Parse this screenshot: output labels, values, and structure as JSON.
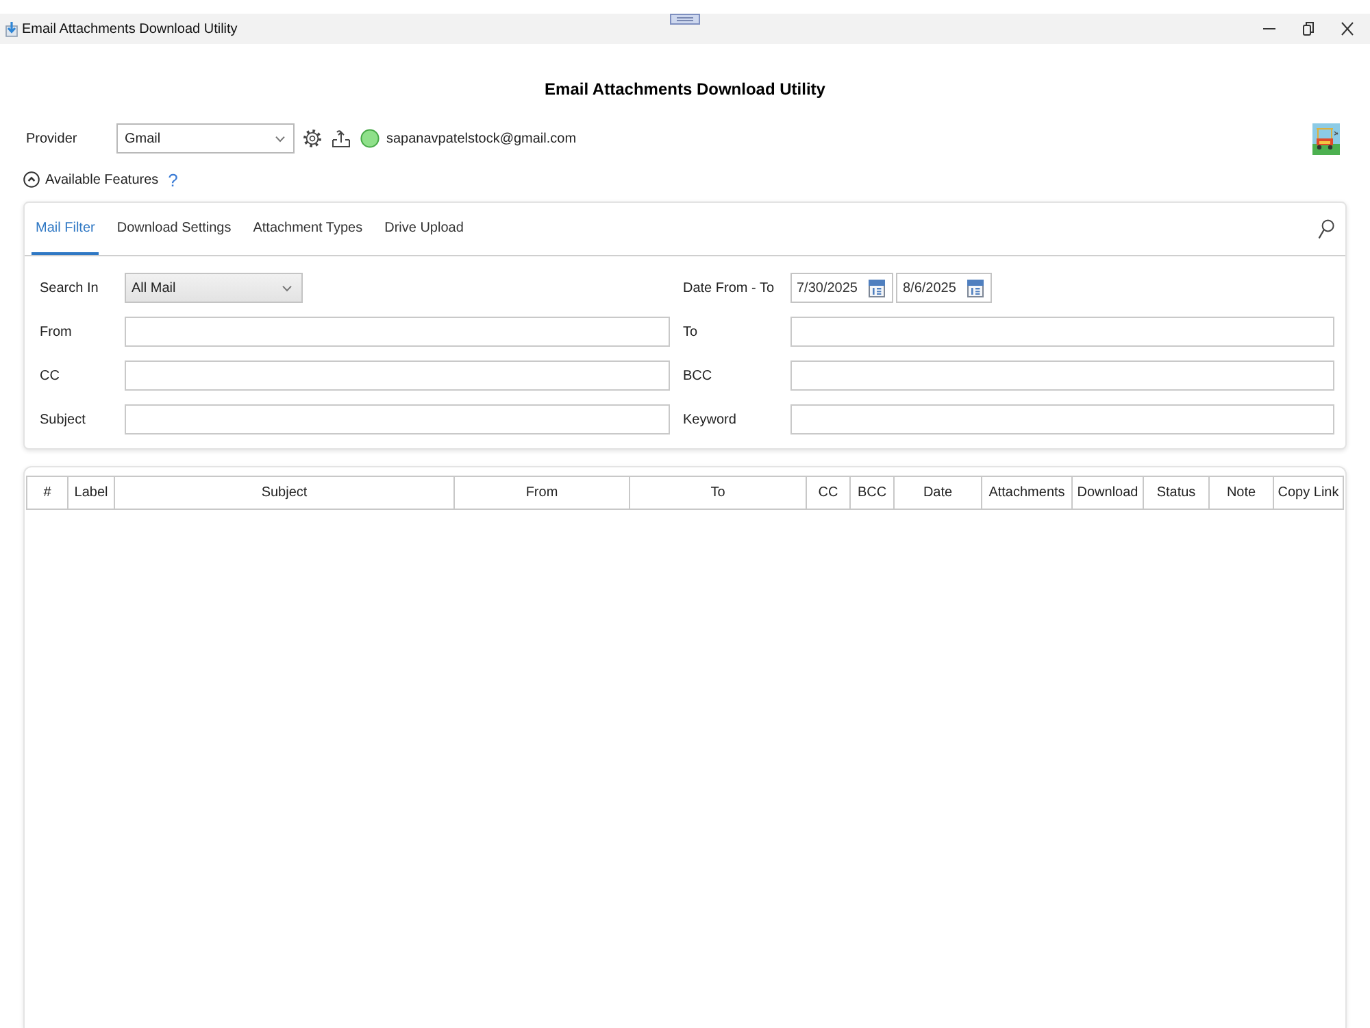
{
  "window": {
    "title": "Email Attachments Download Utility"
  },
  "heading": "Email Attachments Download Utility",
  "provider": {
    "label": "Provider",
    "value": "Gmail",
    "account": "sapanavpatelstock@gmail.com",
    "connected": true
  },
  "features": {
    "label": "Available Features",
    "expanded": true,
    "help": "?"
  },
  "tabs": [
    {
      "label": "Mail Filter",
      "selected": true
    },
    {
      "label": "Download Settings",
      "selected": false
    },
    {
      "label": "Attachment Types",
      "selected": false
    },
    {
      "label": "Drive Upload",
      "selected": false
    }
  ],
  "filter_fields": [
    {
      "label": "Search In",
      "kind": "select",
      "value": "All Mail"
    },
    {
      "label": "Date From - To",
      "kind": "date_range",
      "values": [
        "7/30/2025",
        "8/6/2025"
      ]
    },
    {
      "label": "From",
      "kind": "text"
    },
    {
      "label": "To",
      "kind": "text"
    },
    {
      "label": "CC",
      "kind": "text"
    },
    {
      "label": "BCC",
      "kind": "text"
    },
    {
      "label": "Subject",
      "kind": "text"
    },
    {
      "label": "Keyword",
      "kind": "text"
    }
  ],
  "table": {
    "columns": [
      "#",
      "Label",
      "Subject",
      "From",
      "To",
      "CC",
      "BCC",
      "Date",
      "Attachments",
      "Download",
      "Status",
      "Note",
      "Copy Link"
    ]
  }
}
